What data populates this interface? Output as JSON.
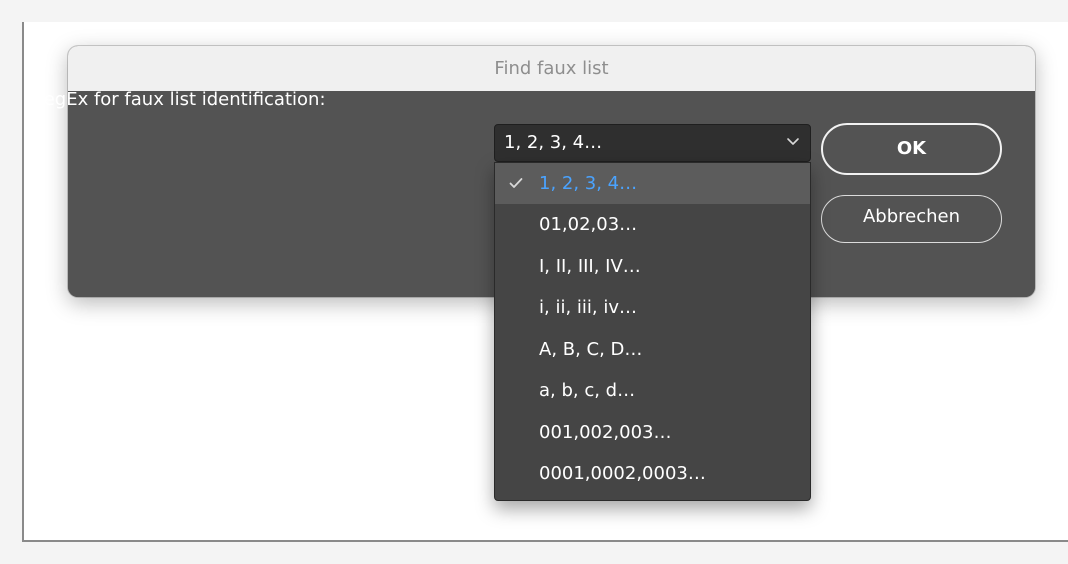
{
  "dialog": {
    "title": "Find faux list",
    "label": "RegEx for faux list identification:",
    "select": {
      "value": "1, 2, 3, 4…",
      "icon": "chevron-down-icon"
    },
    "buttons": {
      "ok_label": "OK",
      "cancel_label": "Abbrechen"
    },
    "dropdown": {
      "selected_index": 0,
      "check_icon": "checkmark-icon",
      "options": [
        "1, 2, 3, 4…",
        "01,02,03…",
        "I, II, III, IV…",
        "i, ii, iii, iv…",
        "A, B, C, D…",
        "a, b, c, d…",
        "001,002,003…",
        "0001,0002,0003…"
      ]
    }
  },
  "colors": {
    "dialog_body": "#535353",
    "titlebar": "#f0f0f0",
    "dropdown_bg": "#454545",
    "selected_text": "#4aa3ff"
  }
}
